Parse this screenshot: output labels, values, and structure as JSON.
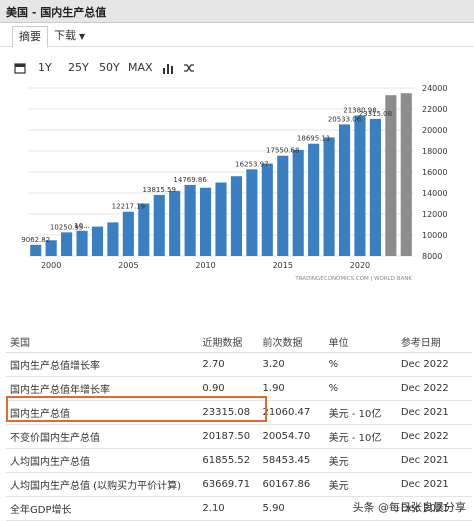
{
  "window": {
    "title": "美国 - 国内生产总值"
  },
  "tabs": {
    "summary": "摘要",
    "download": "下载"
  },
  "toolbar": {
    "ranges": [
      "1Y",
      "25Y",
      "50Y",
      "MAX"
    ]
  },
  "chart_data": {
    "type": "bar",
    "x": [
      1999,
      2000,
      2001,
      2002,
      2003,
      2004,
      2005,
      2006,
      2007,
      2008,
      2009,
      2010,
      2011,
      2012,
      2013,
      2014,
      2015,
      2016,
      2017,
      2018,
      2019,
      2020,
      2021,
      2022,
      2023
    ],
    "values": [
      9062.82,
      9500,
      10250.95,
      10400,
      10800,
      11200,
      12217.19,
      13000,
      13815.59,
      14200,
      14769.86,
      14500,
      15000,
      15600,
      16253.97,
      16800,
      17550.68,
      18100,
      18695.11,
      19300,
      20533.06,
      21380.98,
      21060,
      23315.08,
      23500
    ],
    "ylim": [
      8000,
      24000
    ],
    "y_ticks": [
      8000,
      10000,
      12000,
      14000,
      16000,
      18000,
      20000,
      22000,
      24000
    ],
    "x_ticks": [
      "2000",
      "2005",
      "2010",
      "2015",
      "2020"
    ],
    "x_tick_years": [
      2000,
      2005,
      2010,
      2015,
      2020
    ],
    "data_labels": [
      {
        "year": 1999,
        "text": "9062.82"
      },
      {
        "year": 2001,
        "text": "10250.95"
      },
      {
        "year": 2002,
        "text": "10..."
      },
      {
        "year": 2005,
        "text": "12217.19"
      },
      {
        "year": 2007,
        "text": "13815.59"
      },
      {
        "year": 2009,
        "text": "14769.86"
      },
      {
        "year": 2013,
        "text": "16253.97"
      },
      {
        "year": 2015,
        "text": "17550.68"
      },
      {
        "year": 2017,
        "text": "18695.11"
      },
      {
        "year": 2019,
        "text": "20533.06"
      },
      {
        "year": 2020,
        "text": "21380.98"
      },
      {
        "year": 2021,
        "text": "23315.08"
      }
    ],
    "gray_years": [
      2022,
      2023
    ],
    "bar_color": "#3a7fc1",
    "gray_color": "#8c8c8c",
    "watermark": "TRADINGECONOMICS.COM | WORLD BANK"
  },
  "table": {
    "headers": [
      "美国",
      "近期数据",
      "前次数据",
      "单位",
      "参考日期"
    ],
    "rows": [
      [
        "国内生产总值增长率",
        "2.70",
        "3.20",
        "%",
        "Dec 2022"
      ],
      [
        "国内生产总值年增长率",
        "0.90",
        "1.90",
        "%",
        "Dec 2022"
      ],
      [
        "国内生产总值",
        "23315.08",
        "21060.47",
        "美元 - 10亿",
        "Dec 2021"
      ],
      [
        "不变价国内生产总值",
        "20187.50",
        "20054.70",
        "美元 - 10亿",
        "Dec 2022"
      ],
      [
        "人均国内生产总值",
        "61855.52",
        "58453.45",
        "美元",
        "Dec 2021"
      ],
      [
        "人均国内生产总值 (以购买力平价计算)",
        "63669.71",
        "60167.86",
        "美元",
        "Dec 2021"
      ],
      [
        "全年GDP增长",
        "2.10",
        "5.90",
        "",
        "Dec 2021"
      ]
    ]
  },
  "watermark": "头条 @每日张良晨分享",
  "colors": {
    "highlight": "#e06a2e"
  }
}
